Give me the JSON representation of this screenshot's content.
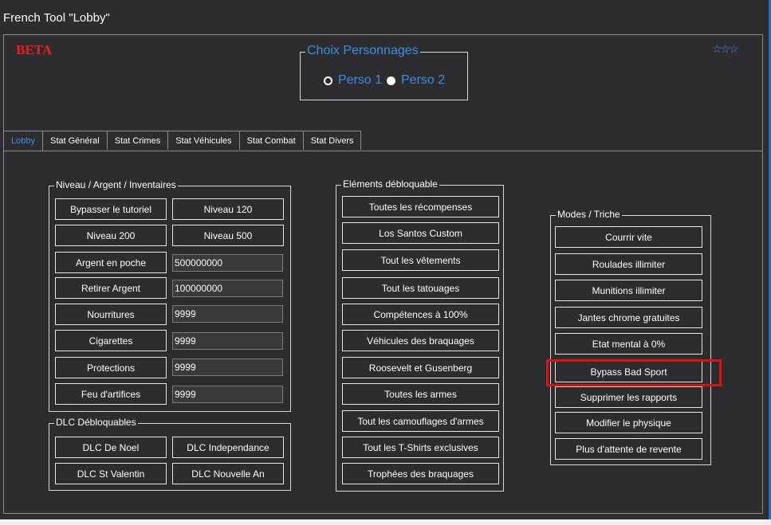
{
  "window": {
    "title": "French Tool \"Lobby\""
  },
  "header": {
    "beta": "BETA",
    "stars": "☆☆☆"
  },
  "character_choice": {
    "title": "Choix Personnages",
    "options": [
      {
        "label": "Perso 1",
        "checked": true
      },
      {
        "label": "Perso 2",
        "checked": false
      }
    ]
  },
  "tabs": [
    "Lobby",
    "Stat Général",
    "Stat Crimes",
    "Stat Véhicules",
    "Stat Combat",
    "Stat Divers"
  ],
  "active_tab": "Lobby",
  "niveau_group": {
    "title": "Niveau / Argent / Inventaires",
    "bypass_tutorial": "Bypasser le tutoriel",
    "level_120": "Niveau 120",
    "level_200": "Niveau 200",
    "level_500": "Niveau 500",
    "rows": [
      {
        "label": "Argent en poche",
        "value": "500000000"
      },
      {
        "label": "Retirer Argent",
        "value": "100000000"
      },
      {
        "label": "Nourritures",
        "value": "9999"
      },
      {
        "label": "Cigarettes",
        "value": "9999"
      },
      {
        "label": "Protections",
        "value": "9999"
      },
      {
        "label": "Feu d'artifices",
        "value": "9999"
      }
    ]
  },
  "dlc_group": {
    "title": "DLC Débloquables",
    "items": [
      "DLC De Noel",
      "DLC Independance",
      "DLC St Valentin",
      "DLC Nouvelle An"
    ]
  },
  "unlock_group": {
    "title": "Eléments débloquable",
    "items": [
      "Toutes les récompenses",
      "Los Santos Custom",
      "Tout les vêtements",
      "Tout les tatouages",
      "Compétences à 100%",
      "Véhicules des braquages",
      "Roosevelt et Gusenberg",
      "Toutes les armes",
      "Tout les camouflages d'armes",
      "Tout les T-Shirts exclusives",
      "Trophées des braquages"
    ]
  },
  "modes_group": {
    "title": "Modes /  Triche",
    "items": [
      "Courrir vite",
      "Roulades illimiter",
      "Munitions illimiter",
      "Jantes chrome gratuites",
      "Etat mental à 0%",
      "Bypass Bad Sport",
      "Supprimer les rapports",
      "Modifier le physique",
      "Plus d'attente de revente"
    ],
    "highlighted": "Bypass Bad Sport"
  },
  "colors": {
    "accent": "#3a8ee6",
    "beta": "#ee1c1c",
    "highlight": "#e01010",
    "background": "#2d2d30"
  }
}
